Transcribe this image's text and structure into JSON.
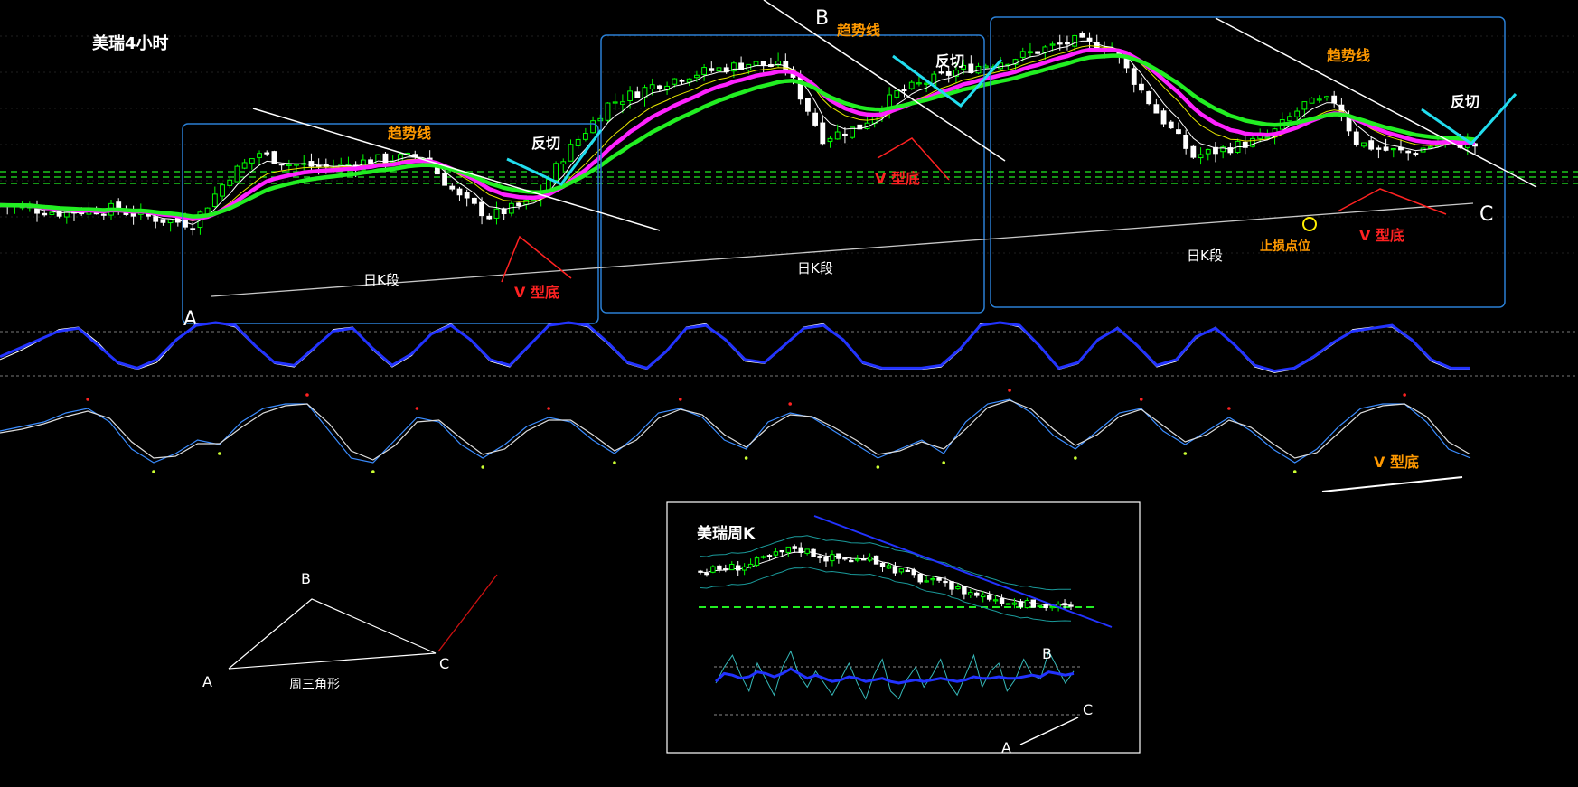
{
  "title": "美瑞4小时",
  "labels": {
    "trend_line": "趋势线",
    "counter_cut": "反切",
    "v_bottom": "V 型底",
    "daily_segment": "日K段",
    "stop_loss": "止损点位",
    "point_a": "A",
    "point_b": "B",
    "point_c": "C",
    "weekly_triangle": "周三角形",
    "weekly_chart_title": "美瑞周K"
  },
  "colors": {
    "background": "#000000",
    "bull_candle": "#00ff00",
    "bear_candle": "#ffffff",
    "ma_magenta": "#ff22ff",
    "ma_green": "#22ee22",
    "ma_white": "#ffffff",
    "ma_yellow": "#e8e800",
    "box_border": "#2a7fd4",
    "trend_line": "#ffffff",
    "counter_cut": "#22ddee",
    "v_bottom": "#ff2222",
    "orange_label": "#ff9900",
    "osc_blue": "#2233ff",
    "osc_light_blue": "#3a8cff",
    "stop_circle": "#ffee00"
  },
  "chart_data": [
    {
      "type": "candlestick",
      "title": "美瑞4小时",
      "n_bars": 200,
      "price_path": [
        [
          0,
          45
        ],
        [
          8,
          43
        ],
        [
          15,
          44
        ],
        [
          22,
          41
        ],
        [
          26,
          40
        ],
        [
          31,
          53
        ],
        [
          35,
          59
        ],
        [
          39,
          56
        ],
        [
          45,
          55
        ],
        [
          50,
          57
        ],
        [
          57,
          58
        ],
        [
          62,
          47
        ],
        [
          66,
          42
        ],
        [
          72,
          46
        ],
        [
          76,
          58
        ],
        [
          82,
          72
        ],
        [
          88,
          77
        ],
        [
          93,
          80
        ],
        [
          101,
          83
        ],
        [
          106,
          82
        ],
        [
          111,
          63
        ],
        [
          116,
          66
        ],
        [
          121,
          75
        ],
        [
          129,
          81
        ],
        [
          136,
          84
        ],
        [
          141,
          87
        ],
        [
          145,
          89
        ],
        [
          150,
          87
        ],
        [
          156,
          70
        ],
        [
          161,
          58
        ],
        [
          165,
          60
        ],
        [
          171,
          63
        ],
        [
          176,
          72
        ],
        [
          180,
          73
        ],
        [
          183,
          62
        ],
        [
          186,
          60
        ],
        [
          190,
          59
        ],
        [
          195,
          62
        ],
        [
          199,
          61
        ]
      ],
      "moving_averages": [
        "magenta",
        "green",
        "white",
        "yellow"
      ],
      "horizontal_levels": 3
    },
    {
      "type": "line",
      "title": "",
      "panel": "oscillator-1",
      "series": [
        {
          "color": "blue",
          "values": [
            40,
            55,
            70,
            85,
            90,
            60,
            30,
            20,
            35,
            70,
            95,
            100,
            95,
            60,
            30,
            25,
            55,
            85,
            90,
            55,
            25,
            45,
            80,
            95,
            70,
            35,
            25,
            60,
            95,
            100,
            95,
            65,
            30,
            20,
            50,
            90,
            95,
            70,
            35,
            30,
            60,
            90,
            95,
            70,
            30,
            20,
            20,
            20,
            25,
            55,
            95,
            100,
            95,
            60,
            20,
            30,
            70,
            90,
            60,
            25,
            35,
            75,
            90,
            60,
            25,
            15,
            20,
            40,
            65,
            85,
            90,
            95,
            70,
            35,
            20,
            20
          ]
        },
        {
          "color": "white",
          "values": [
            35,
            50,
            68,
            88,
            92,
            65,
            28,
            18,
            30,
            68,
            98,
            100,
            92,
            58,
            28,
            22,
            52,
            88,
            92,
            52,
            22,
            42,
            82,
            98,
            68,
            32,
            22,
            58,
            98,
            100,
            92,
            62,
            28,
            18,
            48,
            92,
            98,
            68,
            32,
            28,
            58,
            92,
            98,
            68,
            28,
            18,
            18,
            18,
            22,
            52,
            98,
            100,
            92,
            58,
            18,
            28,
            68,
            92,
            58,
            22,
            32,
            72,
            92,
            58,
            22,
            12,
            18,
            38,
            62,
            88,
            92,
            92,
            68,
            32,
            18,
            18
          ]
        }
      ],
      "levels": [
        80,
        20
      ]
    },
    {
      "type": "line",
      "title": "",
      "panel": "oscillator-2",
      "series": [
        {
          "color": "light-blue",
          "values": [
            60,
            65,
            70,
            80,
            85,
            70,
            40,
            25,
            35,
            50,
            45,
            70,
            85,
            90,
            90,
            60,
            30,
            25,
            50,
            75,
            70,
            45,
            30,
            45,
            65,
            75,
            70,
            50,
            35,
            55,
            80,
            85,
            75,
            50,
            40,
            70,
            80,
            75,
            60,
            45,
            30,
            40,
            50,
            35,
            70,
            90,
            95,
            80,
            55,
            40,
            60,
            80,
            85,
            60,
            45,
            60,
            75,
            60,
            40,
            25,
            40,
            65,
            85,
            90,
            90,
            70,
            40,
            30
          ]
        },
        {
          "color": "white",
          "values": [
            58,
            62,
            68,
            76,
            82,
            74,
            48,
            30,
            32,
            46,
            46,
            64,
            80,
            88,
            90,
            68,
            38,
            28,
            44,
            70,
            72,
            52,
            34,
            40,
            60,
            72,
            72,
            56,
            38,
            50,
            74,
            84,
            78,
            56,
            42,
            64,
            78,
            76,
            64,
            50,
            34,
            38,
            48,
            40,
            62,
            86,
            94,
            84,
            62,
            44,
            56,
            76,
            84,
            66,
            48,
            56,
            72,
            64,
            46,
            30,
            36,
            58,
            80,
            88,
            90,
            76,
            48,
            34
          ]
        }
      ]
    },
    {
      "type": "candlestick",
      "title": "美瑞周K",
      "n_bars": 60,
      "price_path": [
        [
          0,
          45
        ],
        [
          8,
          50
        ],
        [
          15,
          62
        ],
        [
          20,
          55
        ],
        [
          28,
          52
        ],
        [
          35,
          40
        ],
        [
          45,
          28
        ],
        [
          52,
          22
        ],
        [
          59,
          20
        ]
      ],
      "moving_averages": [
        "white",
        "teal-upper-band",
        "teal-lower-band"
      ]
    },
    {
      "type": "line",
      "title": "",
      "panel": "weekly-oscillator",
      "series": [
        {
          "color": "teal",
          "values": [
            50,
            70,
            85,
            60,
            40,
            75,
            55,
            35,
            70,
            90,
            60,
            45,
            65,
            50,
            35,
            55,
            75,
            50,
            30,
            60,
            80,
            40,
            30,
            55,
            70,
            45,
            60,
            80,
            50,
            35,
            60,
            85,
            45,
            65,
            75,
            40,
            55,
            80,
            60,
            55,
            90,
            70,
            50,
            65
          ]
        },
        {
          "color": "blue",
          "values": [
            52,
            62,
            60,
            56,
            58,
            64,
            62,
            58,
            62,
            68,
            62,
            56,
            60,
            56,
            52,
            54,
            58,
            56,
            52,
            54,
            56,
            52,
            50,
            52,
            54,
            52,
            54,
            56,
            54,
            52,
            54,
            58,
            56,
            56,
            58,
            56,
            56,
            58,
            60,
            58,
            64,
            62,
            60,
            62
          ]
        }
      ],
      "levels": [
        80,
        20
      ]
    }
  ]
}
